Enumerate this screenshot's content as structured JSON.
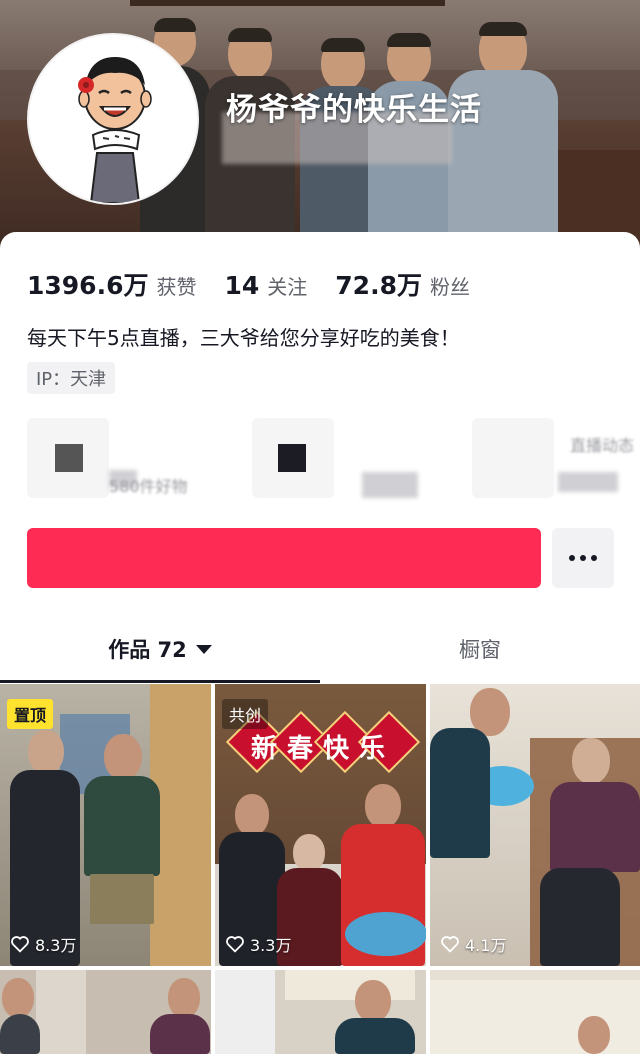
{
  "profile": {
    "nickname": "杨爷爷的快乐生活",
    "stats": [
      {
        "value": "1396.6万",
        "label": "获赞"
      },
      {
        "value": "14",
        "label": "关注"
      },
      {
        "value": "72.8万",
        "label": "粉丝"
      }
    ],
    "bio": "每天下午5点直播，三大爷给您分享好吃的美食！",
    "ip": "IP：天津"
  },
  "entries": [
    {
      "text": "580件好物"
    },
    {
      "text": ""
    },
    {
      "text": "直播动态"
    }
  ],
  "actions": {
    "follow_label": "",
    "more_icon": "more-dots-icon"
  },
  "tabs": {
    "works_label": "作品 72",
    "shop_label": "橱窗"
  },
  "videos": [
    {
      "badge": "置顶",
      "likes": "8.3万"
    },
    {
      "badge": "共创",
      "title": "新春快乐",
      "likes": "3.3万"
    },
    {
      "badge": "",
      "likes": "4.1万"
    },
    {
      "badge": "",
      "likes": ""
    },
    {
      "badge": "",
      "likes": ""
    },
    {
      "badge": "",
      "likes": ""
    }
  ],
  "colors": {
    "follow_button": "#fe2c55",
    "pinned_badge": "#ffe22e",
    "text_primary": "#161823",
    "text_secondary": "#60636b"
  }
}
